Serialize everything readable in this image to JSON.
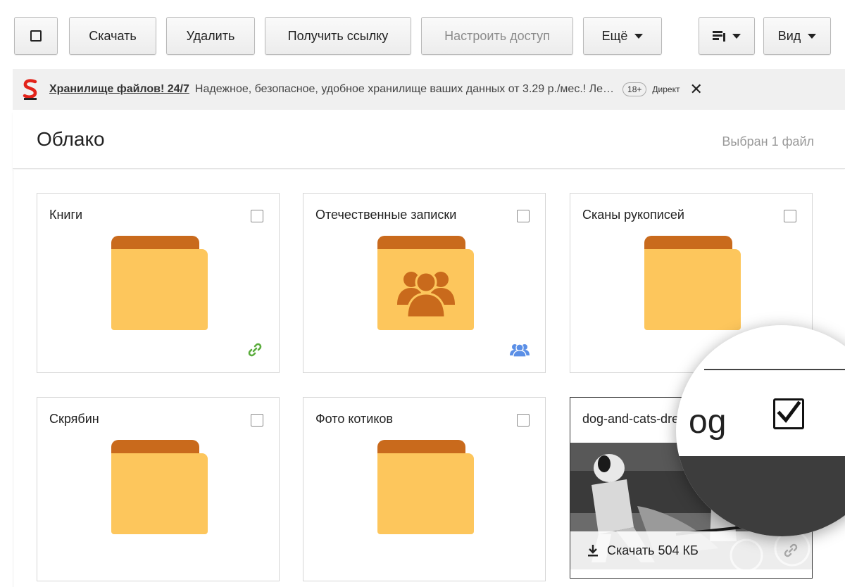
{
  "toolbar": {
    "download_label": "Скачать",
    "delete_label": "Удалить",
    "get_link_label": "Получить ссылку",
    "configure_access_label": "Настроить доступ",
    "more_label": "Ещё",
    "view_label": "Вид"
  },
  "ad": {
    "title": "Хранилище файлов! 24/7",
    "text": "Надежное, безопасное, удобное хранилище ваших данных от 3.29 р./мес.! Ле…",
    "age": "18+",
    "source": "Директ",
    "close": "✕"
  },
  "header": {
    "title": "Облако",
    "status": "Выбран 1 файл"
  },
  "items": [
    {
      "name": "Книги",
      "type": "folder",
      "badge": "link-icon"
    },
    {
      "name": "Отечественные записки",
      "type": "shared-folder",
      "badge": "shared-icon"
    },
    {
      "name": "Сканы рукописей",
      "type": "folder"
    },
    {
      "name": "Скрябин",
      "type": "folder"
    },
    {
      "name": "Фото котиков",
      "type": "folder"
    },
    {
      "name": "dog-and-cats-dre",
      "type": "image",
      "selected": true,
      "download_label": "Скачать 504 КБ"
    }
  ],
  "magnifier": {
    "text": "og"
  },
  "colors": {
    "folder_body": "#fdc65c",
    "folder_tab": "#c96a1c",
    "link_green": "#5aac3c",
    "shared_blue": "#5b8fe6"
  }
}
